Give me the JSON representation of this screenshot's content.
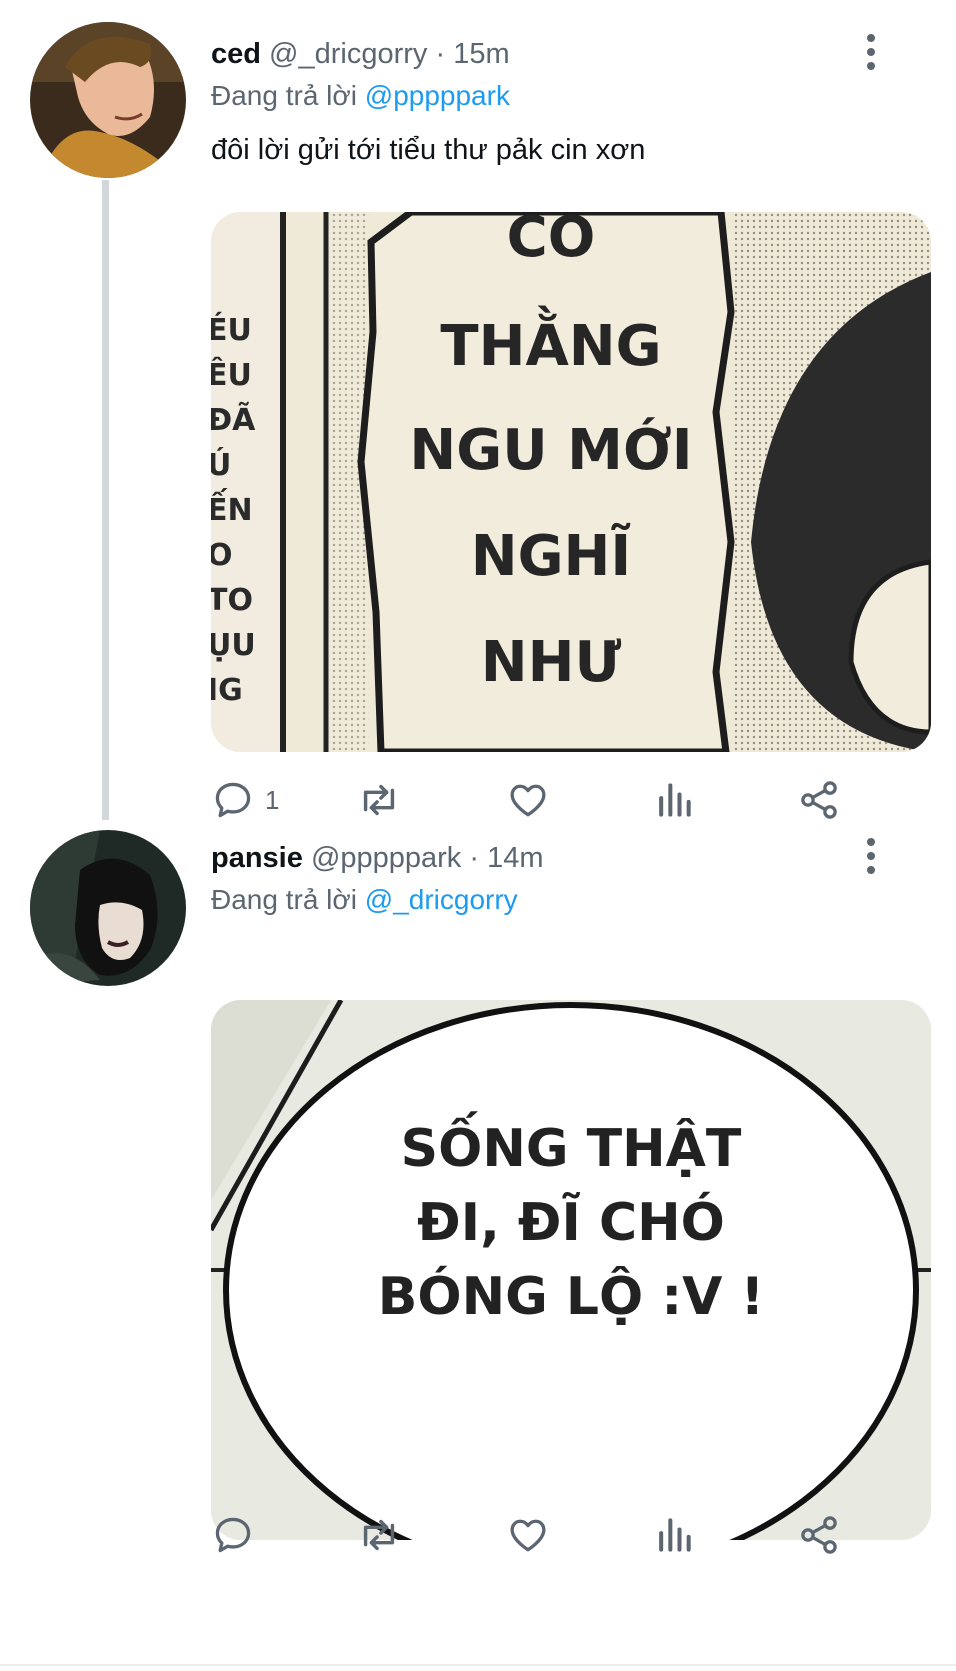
{
  "tweets": [
    {
      "name": "ced",
      "handle": "@_dricgorry",
      "time": "15m",
      "replying_prefix": "Đang trả lời",
      "replying_to": "@pppppark",
      "text": "đôi lời gửi tới tiểu thư pảk cin xơn",
      "media_lines": [
        "CO",
        "THẰNG",
        "NGU MỚI",
        "NGHĨ",
        "NHƯ"
      ],
      "media_side_lines": [
        "ÉU",
        "ÊU",
        "ĐÃ",
        "Ú",
        "ẾN",
        "O",
        "TO",
        "ỤU",
        "IG"
      ],
      "reply_count": "1"
    },
    {
      "name": "pansie",
      "handle": "@pppppark",
      "time": "14m",
      "replying_prefix": "Đang trả lời",
      "replying_to": "@_dricgorry",
      "media_lines": [
        "SỐNG THẬT",
        "ĐI, ĐĨ CHÓ",
        "BÓNG LỘ :V !"
      ],
      "reply_count": ""
    }
  ],
  "separator": "·",
  "icons": {
    "reply": "reply-icon",
    "retweet": "retweet-icon",
    "like": "heart-icon",
    "views": "analytics-icon",
    "share": "share-icon",
    "more": "more-vertical-icon"
  },
  "colors": {
    "mention": "#1d9bf0",
    "muted": "#5b6670",
    "thread_line": "#d3d6da"
  }
}
